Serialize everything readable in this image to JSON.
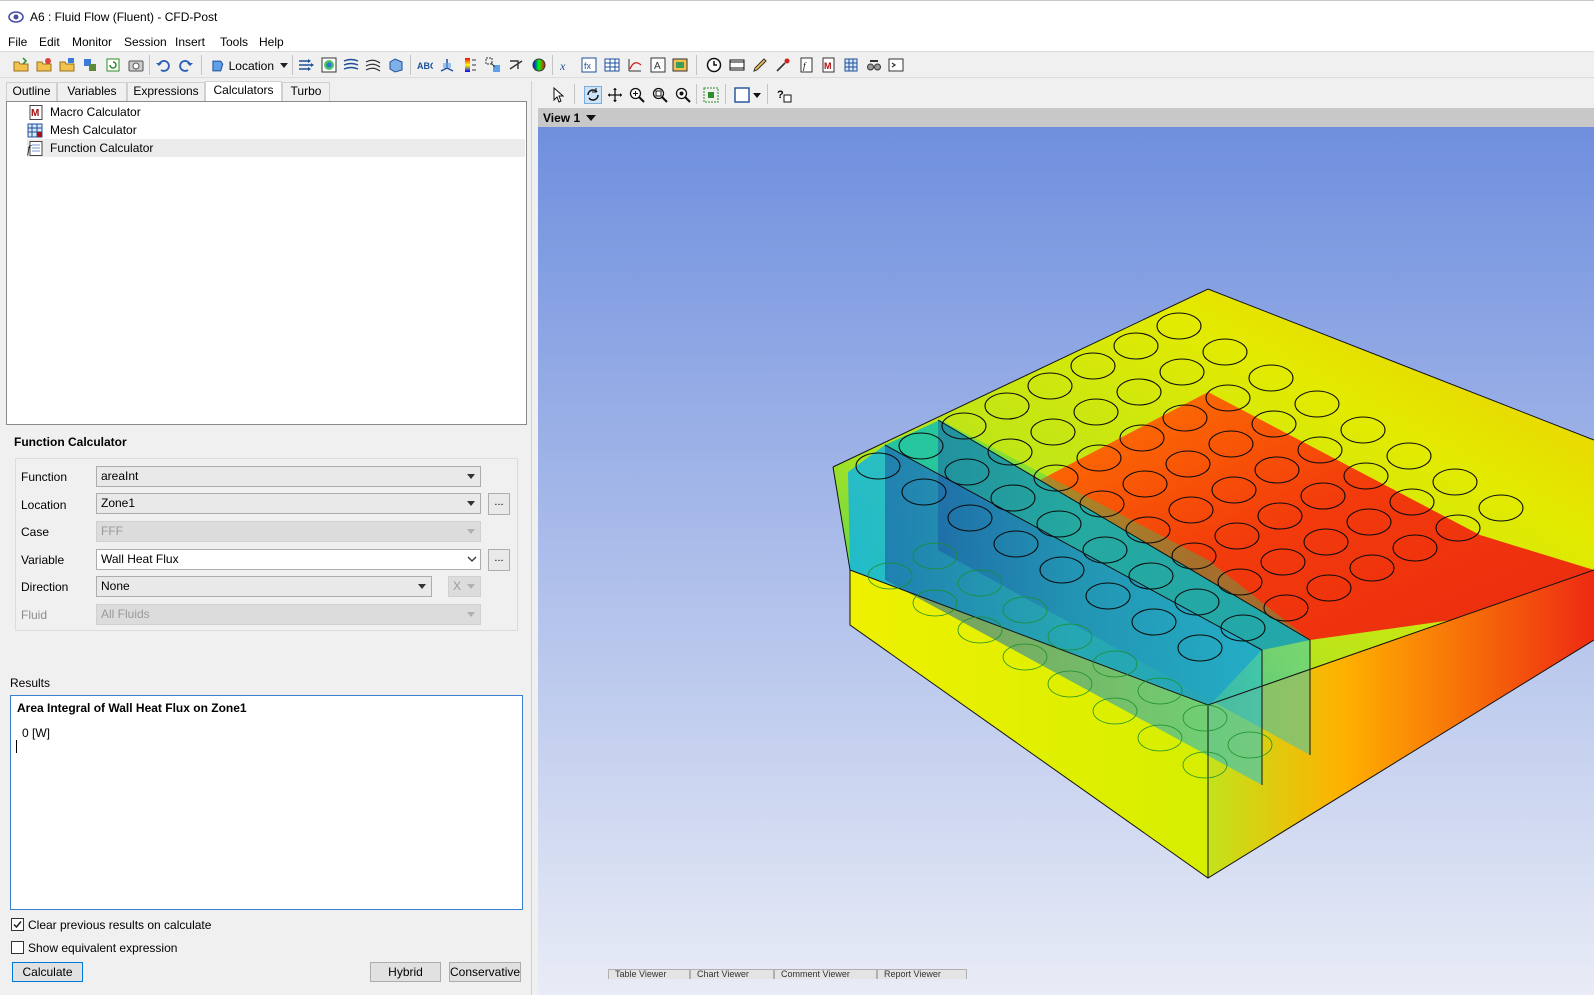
{
  "window": {
    "title": "A6 : Fluid Flow (Fluent) - CFD-Post"
  },
  "menu": [
    "File",
    "Edit",
    "Monitor",
    "Session",
    "Insert",
    "Tools",
    "Help"
  ],
  "toolbar": {
    "location_label": "Location"
  },
  "tabs": [
    "Outline",
    "Variables",
    "Expressions",
    "Calculators",
    "Turbo"
  ],
  "active_tab": "Calculators",
  "calculators": [
    {
      "label": "Macro Calculator",
      "icon": "macro-calculator-icon"
    },
    {
      "label": "Mesh Calculator",
      "icon": "mesh-calculator-icon"
    },
    {
      "label": "Function Calculator",
      "icon": "function-calculator-icon"
    }
  ],
  "function_calculator": {
    "title": "Function Calculator",
    "function": {
      "label": "Function",
      "value": "areaInt"
    },
    "location": {
      "label": "Location",
      "value": "Zone1"
    },
    "case": {
      "label": "Case",
      "value": "FFF"
    },
    "variable": {
      "label": "Variable",
      "value": "Wall Heat Flux"
    },
    "direction": {
      "label": "Direction",
      "value": "None",
      "axis": "X"
    },
    "fluid": {
      "label": "Fluid",
      "value": "All Fluids"
    },
    "more": "..."
  },
  "results": {
    "label": "Results",
    "heading": "Area Integral of Wall Heat Flux on Zone1",
    "value": "0 [W]"
  },
  "options": {
    "clear_previous": {
      "label": "Clear previous results on calculate",
      "checked": true
    },
    "show_equivalent": {
      "label": "Show equivalent expression",
      "checked": false
    }
  },
  "buttons": {
    "calculate": "Calculate",
    "hybrid": "Hybrid",
    "conservative": "Conservative"
  },
  "view": {
    "label": "View 1"
  },
  "bottom_tabs": [
    "Table Viewer",
    "Chart Viewer",
    "Comment Viewer",
    "Report Viewer"
  ],
  "colors": {
    "accent": "#0078d7",
    "viewport_top": "#6f8fde",
    "viewport_bottom": "#e9ecf6",
    "hot": "#f23a0c",
    "warm": "#ff8c00",
    "mid": "#e7ef00",
    "cool": "#19d16a",
    "cold": "#23b7cf"
  }
}
